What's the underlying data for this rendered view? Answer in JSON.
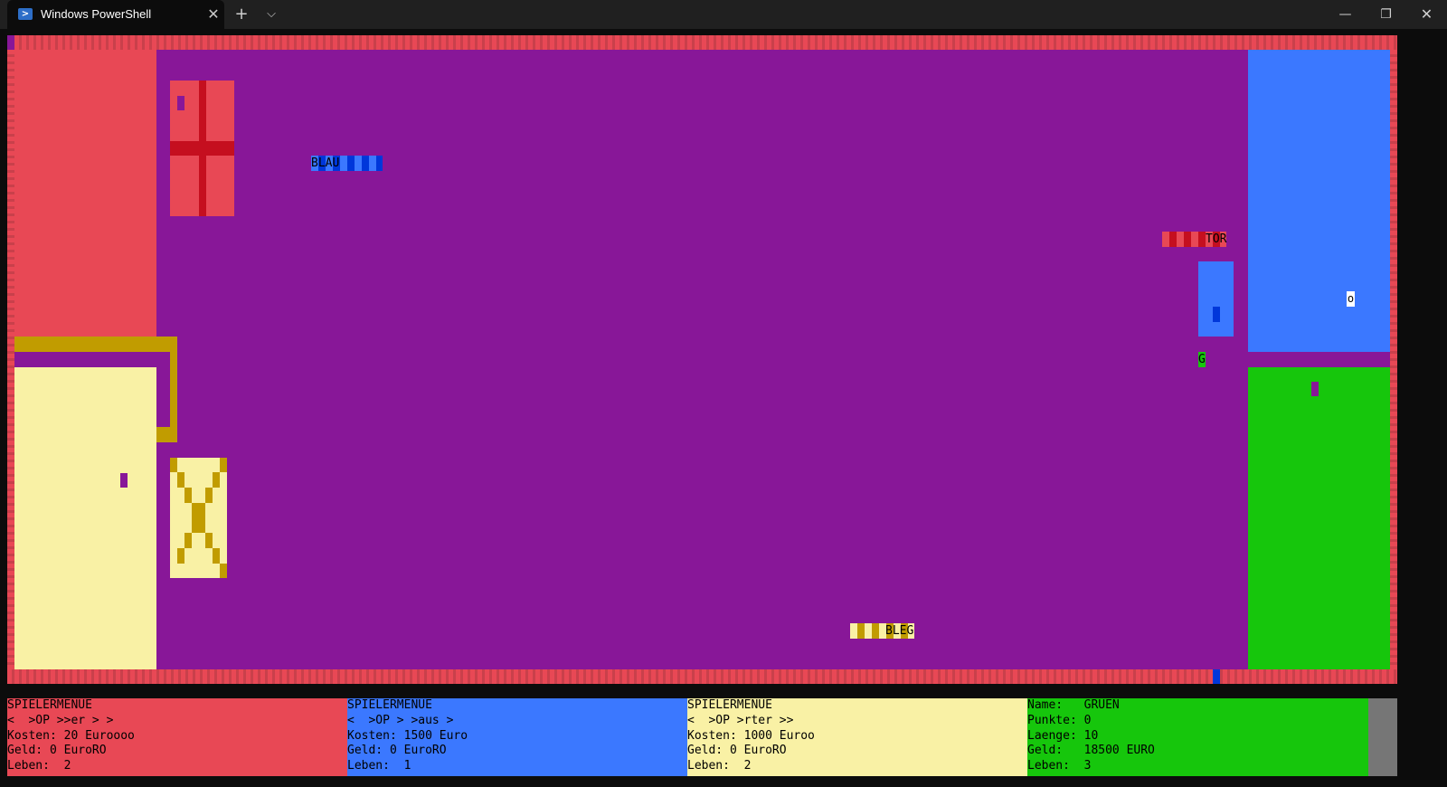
{
  "window": {
    "tab_title": "Windows PowerShell",
    "tab_icon": "powershell-icon",
    "close_tab_glyph": "✕",
    "new_tab_glyph": "+",
    "dropdown_glyph": "⌵",
    "minimize_glyph": "—",
    "maximize_glyph": "❐",
    "close_glyph": "✕"
  },
  "colors": {
    "red": "#e84855",
    "purple": "#881798",
    "blue": "#3b78ff",
    "yellow": "#f9f1a5",
    "green": "#16c60c",
    "gold": "#c19c00",
    "gray": "#767676"
  },
  "board": {
    "labels": {
      "blau": "BLAU",
      "tor": "TOR",
      "bleg": "BLEG",
      "g": "G",
      "o": "o"
    }
  },
  "panels": [
    {
      "color": "red",
      "lines": [
        "SPIELERMENUE",
        "<  >OP >>er > >",
        "Kosten: 20 Euroooo",
        "Geld: 0 EuroRO",
        "Leben:  2"
      ]
    },
    {
      "color": "blue",
      "lines": [
        "SPIELERMENUE",
        "<  >OP > >aus >",
        "Kosten: 1500 Euro",
        "Geld: 0 EuroRO",
        "Leben:  1"
      ]
    },
    {
      "color": "yellow",
      "lines": [
        "SPIELERMENUE",
        "<  >OP >rter >>",
        "Kosten: 1000 Euroo",
        "Geld: 0 EuroRO",
        "Leben:  2"
      ]
    },
    {
      "color": "green",
      "lines": [
        "Name:   GRUEN",
        "Punkte: 0",
        "Laenge: 10",
        "Geld:   18500 EURO",
        "Leben:  3"
      ]
    }
  ]
}
